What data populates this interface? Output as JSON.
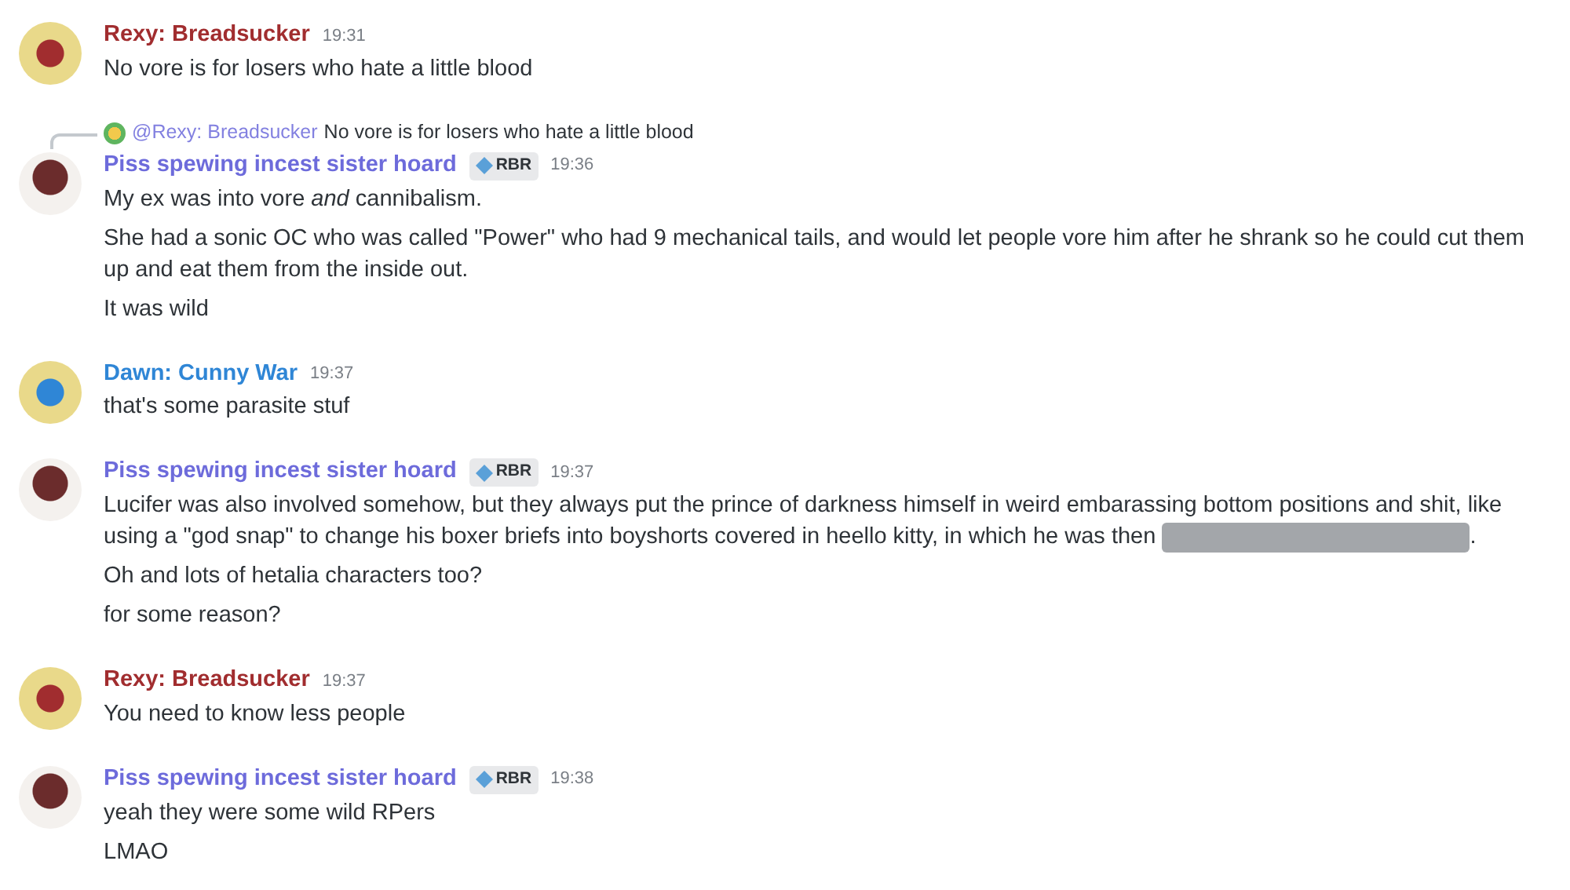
{
  "messages": [
    {
      "author": "Rexy: Breadsucker",
      "color": "#a12d2f",
      "time": "19:31",
      "lines": [
        {
          "text": "No vore is for losers who hate a little blood"
        }
      ]
    },
    {
      "reply": {
        "author": "@Rexy: Breadsucker",
        "text": "No vore is for losers who hate a little blood"
      },
      "author": "Piss spewing incest sister hoard",
      "color": "#6d6bdb",
      "tag": "RBR",
      "time": "19:36",
      "lines": [
        {
          "text": "My ex was into vore *and* cannibalism."
        },
        {
          "text": "She had a sonic OC who was called \"Power\" who had 9 mechanical tails, and would let people vore him after he shrank so he could cut them up and eat them from the inside out."
        },
        {
          "text": "It was wild"
        }
      ]
    },
    {
      "author": "Dawn: Cunny War",
      "color": "#2f86d6",
      "time": "19:37",
      "lines": [
        {
          "text": "that's some parasite stuf"
        }
      ]
    },
    {
      "author": "Piss spewing incest sister hoard",
      "color": "#6d6bdb",
      "tag": "RBR",
      "time": "19:37",
      "lines": [
        {
          "text": "Lucifer was also involved somehow, but they always put the prince of darkness himself in weird embarassing bottom positions and shit, like using a \"god snap\" to change his boxer briefs into boyshorts covered in heello kitty, in which he was then",
          "spoiler": true,
          "after": "."
        },
        {
          "text": "Oh and lots of hetalia characters too?"
        },
        {
          "text": "for some reason?"
        }
      ]
    },
    {
      "author": "Rexy: Breadsucker",
      "color": "#a12d2f",
      "time": "19:37",
      "lines": [
        {
          "text": "You need to know less people"
        }
      ]
    },
    {
      "author": "Piss spewing incest sister hoard",
      "color": "#6d6bdb",
      "tag": "RBR",
      "time": "19:38",
      "lines": [
        {
          "text": "yeah they were some wild RPers"
        },
        {
          "text": "LMAO"
        }
      ]
    }
  ]
}
